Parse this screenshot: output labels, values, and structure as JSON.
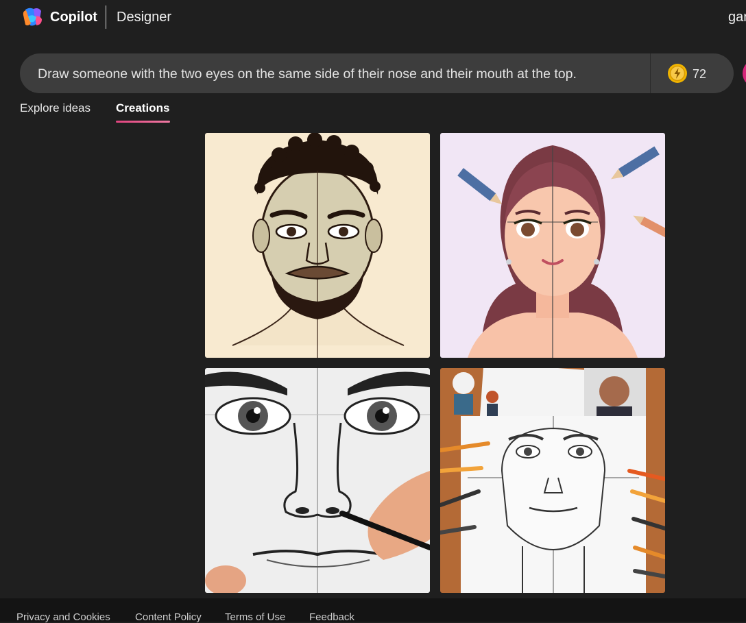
{
  "header": {
    "brand": "Copilot",
    "product": "Designer",
    "user_partial": "gar"
  },
  "prompt": {
    "text": "Draw someone with the two eyes on the same side of their nose and their mouth at the top.",
    "boosts": "72"
  },
  "tabs": [
    {
      "label": "Explore ideas",
      "active": false
    },
    {
      "label": "Creations",
      "active": true
    }
  ],
  "gallery": [
    {
      "subject": "illustrated bearded man face with center guide line"
    },
    {
      "subject": "illustrated woman with long wavy hair and colored pencils"
    },
    {
      "subject": "pencil sketch of eyes and nose with hand holding pencil"
    },
    {
      "subject": "sketch of man's face surrounded by colored pencils and photos"
    }
  ],
  "footer": {
    "links": [
      "Privacy and Cookies",
      "Content Policy",
      "Terms of Use",
      "Feedback"
    ]
  },
  "colors": {
    "background": "#1f1f1f",
    "prompt_bar": "#3d3d3d",
    "tab_accent": "#e0447e",
    "footer": "#141414"
  }
}
